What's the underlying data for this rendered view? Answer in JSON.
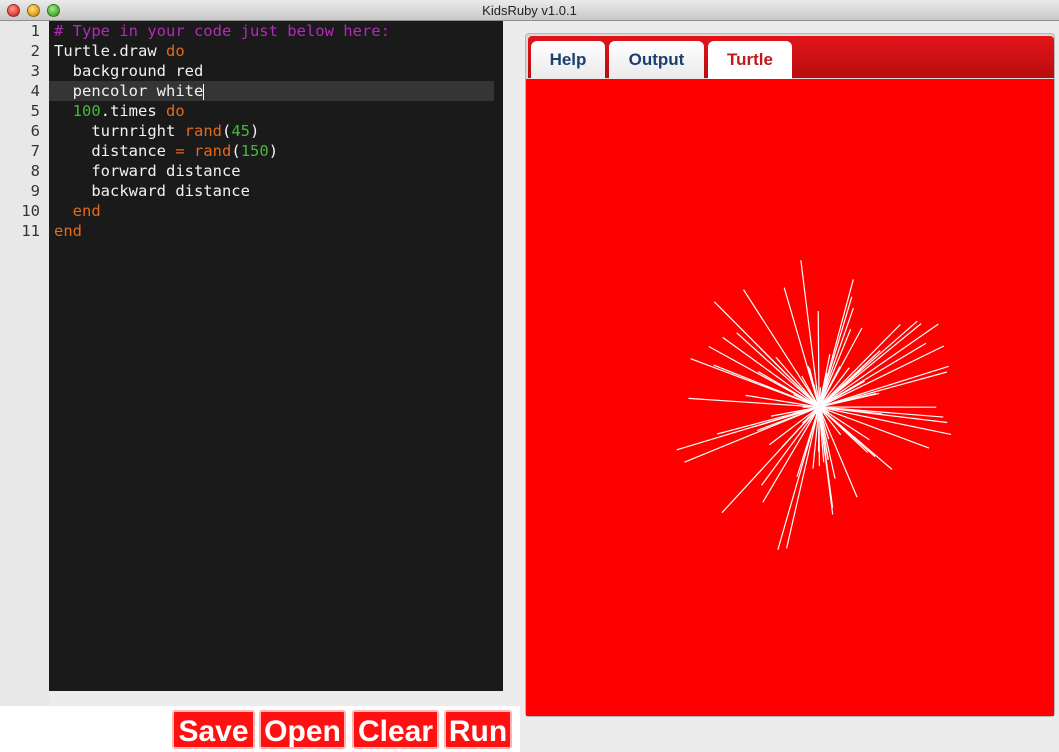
{
  "window": {
    "title": "KidsRuby v1.0.1"
  },
  "editor": {
    "line_numbers": [
      "1",
      "2",
      "3",
      "4",
      "5",
      "6",
      "7",
      "8",
      "9",
      "10",
      "11"
    ],
    "current_line": 4
  },
  "buttons": {
    "save": "Save",
    "open": "Open",
    "clear": "Clear",
    "run": "Run"
  },
  "tabs": [
    {
      "label": "Help",
      "active": false
    },
    {
      "label": "Output",
      "active": false
    },
    {
      "label": "Turtle",
      "active": true
    }
  ],
  "turtle": {
    "background": "#ff0000",
    "pencolor": "#ffffff",
    "center_fraction": [
      0.555,
      0.515
    ]
  },
  "colors": {
    "accent": "#ff1111",
    "comment": "#b22bb8",
    "keyword": "#e36a1a",
    "number": "#45b83a"
  }
}
